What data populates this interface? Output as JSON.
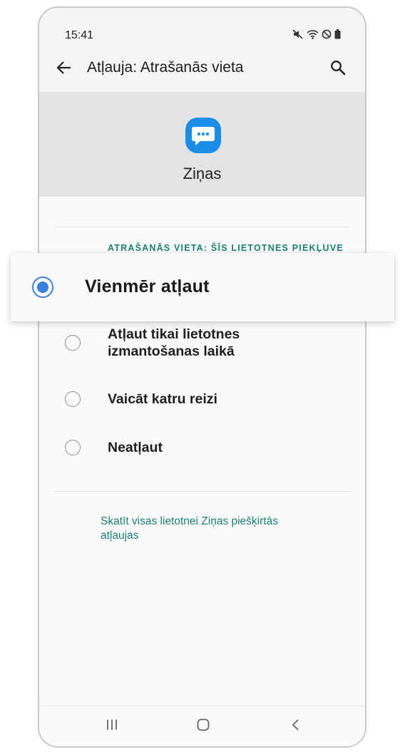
{
  "status_bar": {
    "time": "15:41",
    "icons": [
      "mute-icon",
      "wifi-icon",
      "do-not-disturb-icon",
      "battery-icon"
    ]
  },
  "app_bar": {
    "title": "Atļauja: Atrašanās vieta",
    "back_icon": "arrow-left-icon",
    "search_icon": "search-icon"
  },
  "app_header": {
    "app_name": "Ziņas",
    "icon": "chat-bubble-icon",
    "icon_color": "#1c8ee8"
  },
  "permission": {
    "section_label": "ATRAŠANĀS VIETA: ŠĪS LIETOTNES PIEKĻUVE",
    "options": [
      {
        "label": "Vienmēr atļaut",
        "selected": true
      },
      {
        "label_line1": "Atļaut tikai lietotnes",
        "label_line2": "izmantošanas laikā",
        "selected": false
      },
      {
        "label": "Vaicāt katru reizi",
        "selected": false
      },
      {
        "label": "Neatļaut",
        "selected": false
      }
    ]
  },
  "footer_link": {
    "line1": "Skatīt visas lietotnei Ziņas piešķirtās",
    "line2": "atļaujas"
  },
  "nav_bar": {
    "icons": [
      "recent-apps-icon",
      "home-icon",
      "back-icon"
    ]
  },
  "colors": {
    "accent": "#1a7f73",
    "radio_selected": "#3a7fde"
  }
}
